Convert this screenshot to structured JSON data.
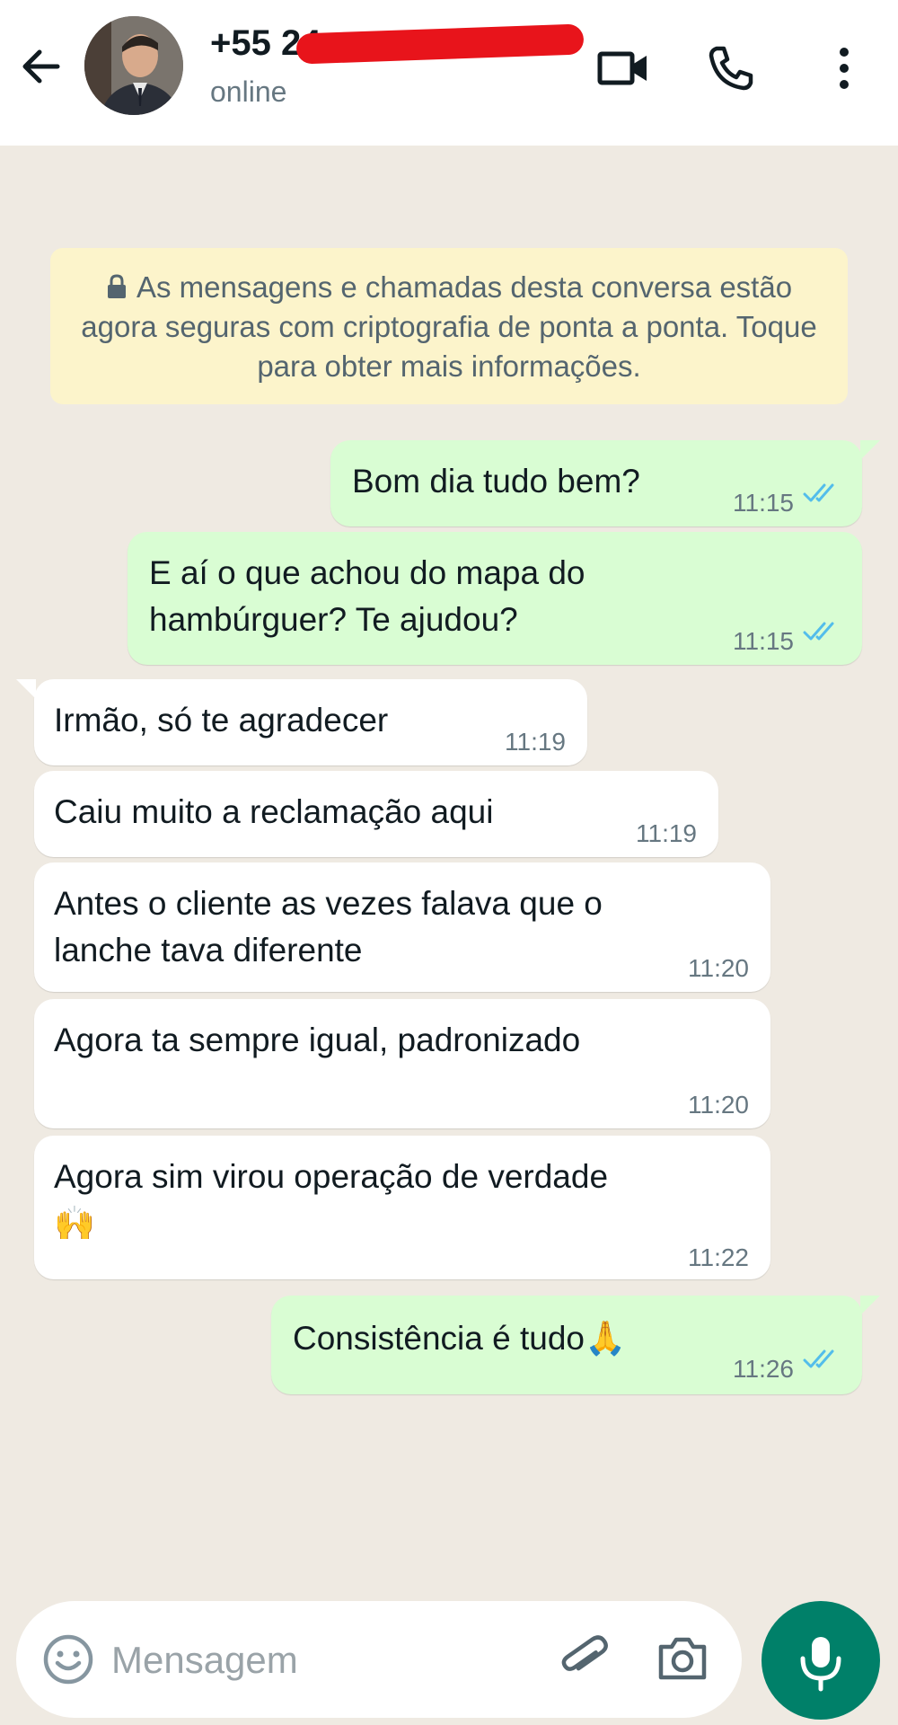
{
  "header": {
    "contact_name": "+55 24",
    "status": "online",
    "icons": [
      "arrow-left-icon",
      "video-camera-icon",
      "phone-icon",
      "more-vertical-icon"
    ]
  },
  "notice": {
    "text": "As mensagens e chamadas desta conversa estão agora seguras com criptografia de ponta a ponta. Toque para obter mais informações."
  },
  "messages": [
    {
      "direction": "out",
      "text": "Bom dia tudo bem?",
      "time": "11:15",
      "read": true
    },
    {
      "direction": "out",
      "text": "E aí o que achou do mapa do\nhambúrguer? Te ajudou?",
      "time": "11:15",
      "read": true
    },
    {
      "direction": "in",
      "text": "Irmão, só te agradecer",
      "time": "11:19"
    },
    {
      "direction": "in",
      "text": "Caiu muito a reclamação aqui",
      "time": "11:19"
    },
    {
      "direction": "in",
      "text": "Antes o cliente as vezes falava que o\nlanche tava diferente",
      "time": "11:20"
    },
    {
      "direction": "in",
      "text": "Agora ta sempre igual, padronizado",
      "time": "11:20"
    },
    {
      "direction": "in",
      "text": "Agora sim virou operação de verdade\n🙌",
      "time": "11:22"
    },
    {
      "direction": "out",
      "text": "Consistência é tudo🙏",
      "time": "11:26",
      "read": true
    }
  ],
  "input_bar": {
    "placeholder": "Mensagem",
    "icons": [
      "emoji-icon",
      "paperclip-icon",
      "camera-icon",
      "microphone-icon"
    ]
  },
  "colors": {
    "header_bg": "#ffffff",
    "chat_bg": "#efeae2",
    "outgoing_bubble": "#d9fdd3",
    "incoming_bubble": "#ffffff",
    "notice_bg": "#fcf4cb",
    "read_ticks": "#53bdeb",
    "accent": "#008069"
  }
}
